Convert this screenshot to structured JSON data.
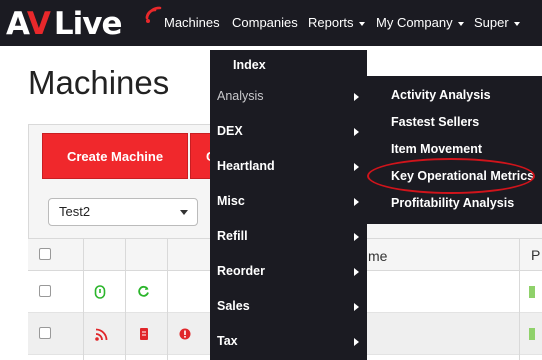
{
  "brand": {
    "logo_a": "A",
    "logo_v": "V",
    "logo_live": "Live"
  },
  "nav": {
    "machines": "Machines",
    "companies": "Companies",
    "reports": "Reports",
    "my_company": "My Company",
    "super": "Super"
  },
  "page_title": "Machines",
  "toolbar": {
    "create_machine": "Create Machine",
    "second_button_partial": "C",
    "filter_select_value": "Test2"
  },
  "table": {
    "header_name_partial": "me",
    "header_p_partial": "P"
  },
  "reports_menu": {
    "items": [
      {
        "label": "Index",
        "submenu": false
      },
      {
        "label": "Analysis",
        "submenu": true,
        "active": true
      },
      {
        "label": "DEX",
        "submenu": true
      },
      {
        "label": "Heartland",
        "submenu": true
      },
      {
        "label": "Misc",
        "submenu": true
      },
      {
        "label": "Refill",
        "submenu": true
      },
      {
        "label": "Reorder",
        "submenu": true
      },
      {
        "label": "Sales",
        "submenu": true
      },
      {
        "label": "Tax",
        "submenu": true
      }
    ]
  },
  "analysis_submenu": {
    "items": [
      {
        "label": "Activity Analysis"
      },
      {
        "label": "Fastest Sellers"
      },
      {
        "label": "Item Movement"
      },
      {
        "label": "Key Operational Metrics",
        "highlighted": true
      },
      {
        "label": "Profitability Analysis"
      }
    ]
  },
  "colors": {
    "navbar_bg": "#1b1b22",
    "brand_red": "#e8282b",
    "button_red": "#f0282c",
    "highlight_red": "#d0141b",
    "status_green": "#2bb52b",
    "status_red": "#e0262a"
  }
}
